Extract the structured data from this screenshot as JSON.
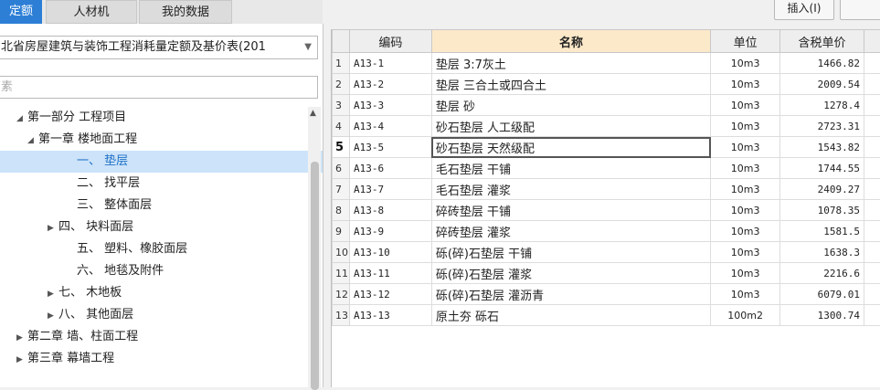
{
  "tabs": [
    {
      "label": "定额",
      "active": true
    },
    {
      "label": "人材机",
      "active": false
    },
    {
      "label": "我的数据",
      "active": false
    }
  ],
  "toolbar": {
    "insert_label": "插入(I)"
  },
  "library_select": {
    "value": "北省房屋建筑与装饰工程消耗量定额及基价表(201"
  },
  "search": {
    "placeholder": "素"
  },
  "tree": [
    {
      "label": "第一部分 工程项目",
      "toggle": "◢"
    },
    {
      "label": "第一章 楼地面工程",
      "toggle": "◢"
    },
    {
      "label": "一、 垫层",
      "toggle": ""
    },
    {
      "label": "二、 找平层",
      "toggle": ""
    },
    {
      "label": "三、 整体面层",
      "toggle": ""
    },
    {
      "label": "四、 块料面层",
      "toggle": "▶"
    },
    {
      "label": "五、 塑料、橡胶面层",
      "toggle": ""
    },
    {
      "label": "六、 地毯及附件",
      "toggle": ""
    },
    {
      "label": "七、 木地板",
      "toggle": "▶"
    },
    {
      "label": "八、 其他面层",
      "toggle": "▶"
    },
    {
      "label": "第二章 墙、柱面工程",
      "toggle": "▶"
    },
    {
      "label": "第三章 幕墙工程",
      "toggle": "▶"
    }
  ],
  "grid": {
    "headers": {
      "code": "编码",
      "name": "名称",
      "unit": "单位",
      "price": "含税单价"
    },
    "rows": [
      {
        "n": "1",
        "code": "A13-1",
        "name": "垫层 3:7灰土",
        "unit": "10m3",
        "price": "1466.82"
      },
      {
        "n": "2",
        "code": "A13-2",
        "name": "垫层 三合土或四合土",
        "unit": "10m3",
        "price": "2009.54"
      },
      {
        "n": "3",
        "code": "A13-3",
        "name": "垫层 砂",
        "unit": "10m3",
        "price": "1278.4"
      },
      {
        "n": "4",
        "code": "A13-4",
        "name": "砂石垫层 人工级配",
        "unit": "10m3",
        "price": "2723.31"
      },
      {
        "n": "5",
        "code": "A13-5",
        "name": "砂石垫层 天然级配",
        "unit": "10m3",
        "price": "1543.82"
      },
      {
        "n": "6",
        "code": "A13-6",
        "name": "毛石垫层 干铺",
        "unit": "10m3",
        "price": "1744.55"
      },
      {
        "n": "7",
        "code": "A13-7",
        "name": "毛石垫层 灌浆",
        "unit": "10m3",
        "price": "2409.27"
      },
      {
        "n": "8",
        "code": "A13-8",
        "name": "碎砖垫层 干铺",
        "unit": "10m3",
        "price": "1078.35"
      },
      {
        "n": "9",
        "code": "A13-9",
        "name": "碎砖垫层 灌浆",
        "unit": "10m3",
        "price": "1581.5"
      },
      {
        "n": "10",
        "code": "A13-10",
        "name": "砾(碎)石垫层 干铺",
        "unit": "10m3",
        "price": "1638.3"
      },
      {
        "n": "11",
        "code": "A13-11",
        "name": "砾(碎)石垫层 灌浆",
        "unit": "10m3",
        "price": "2216.6"
      },
      {
        "n": "12",
        "code": "A13-12",
        "name": "砾(碎)石垫层 灌沥青",
        "unit": "10m3",
        "price": "6079.01"
      },
      {
        "n": "13",
        "code": "A13-13",
        "name": "原土夯 砾石",
        "unit": "100m2",
        "price": "1300.74"
      }
    ]
  }
}
